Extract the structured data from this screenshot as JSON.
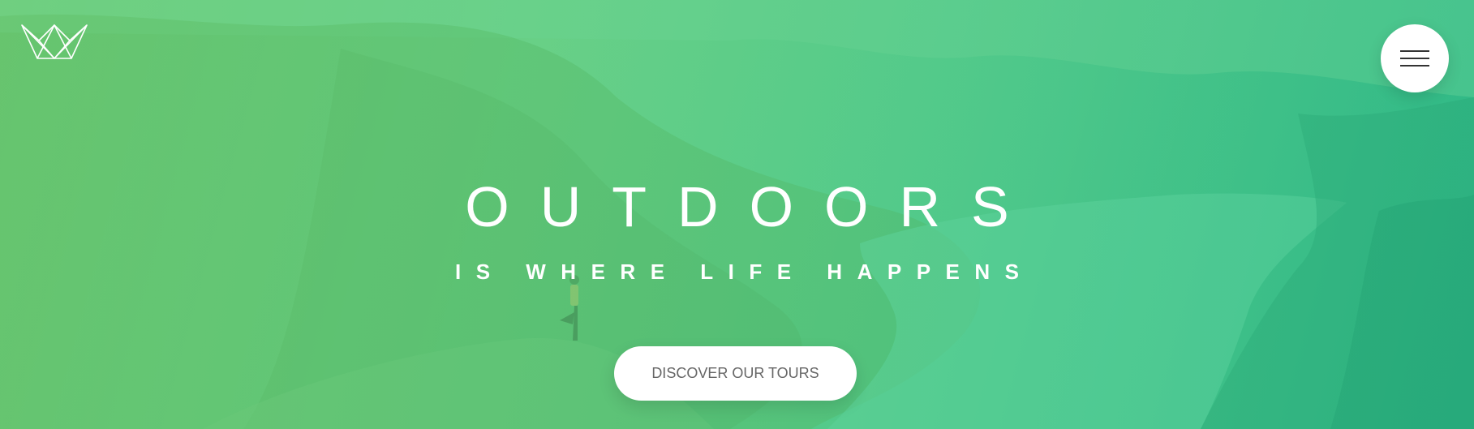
{
  "hero": {
    "title": "OUTDOORS",
    "subtitle": "IS WHERE LIFE HAPPENS",
    "cta_label": "DISCOVER OUR TOURS",
    "overlay_colors": [
      "#7ed56f",
      "#28b485"
    ]
  },
  "header": {
    "logo_icon": "crown-logo-icon",
    "menu_icon": "hamburger-menu-icon"
  }
}
